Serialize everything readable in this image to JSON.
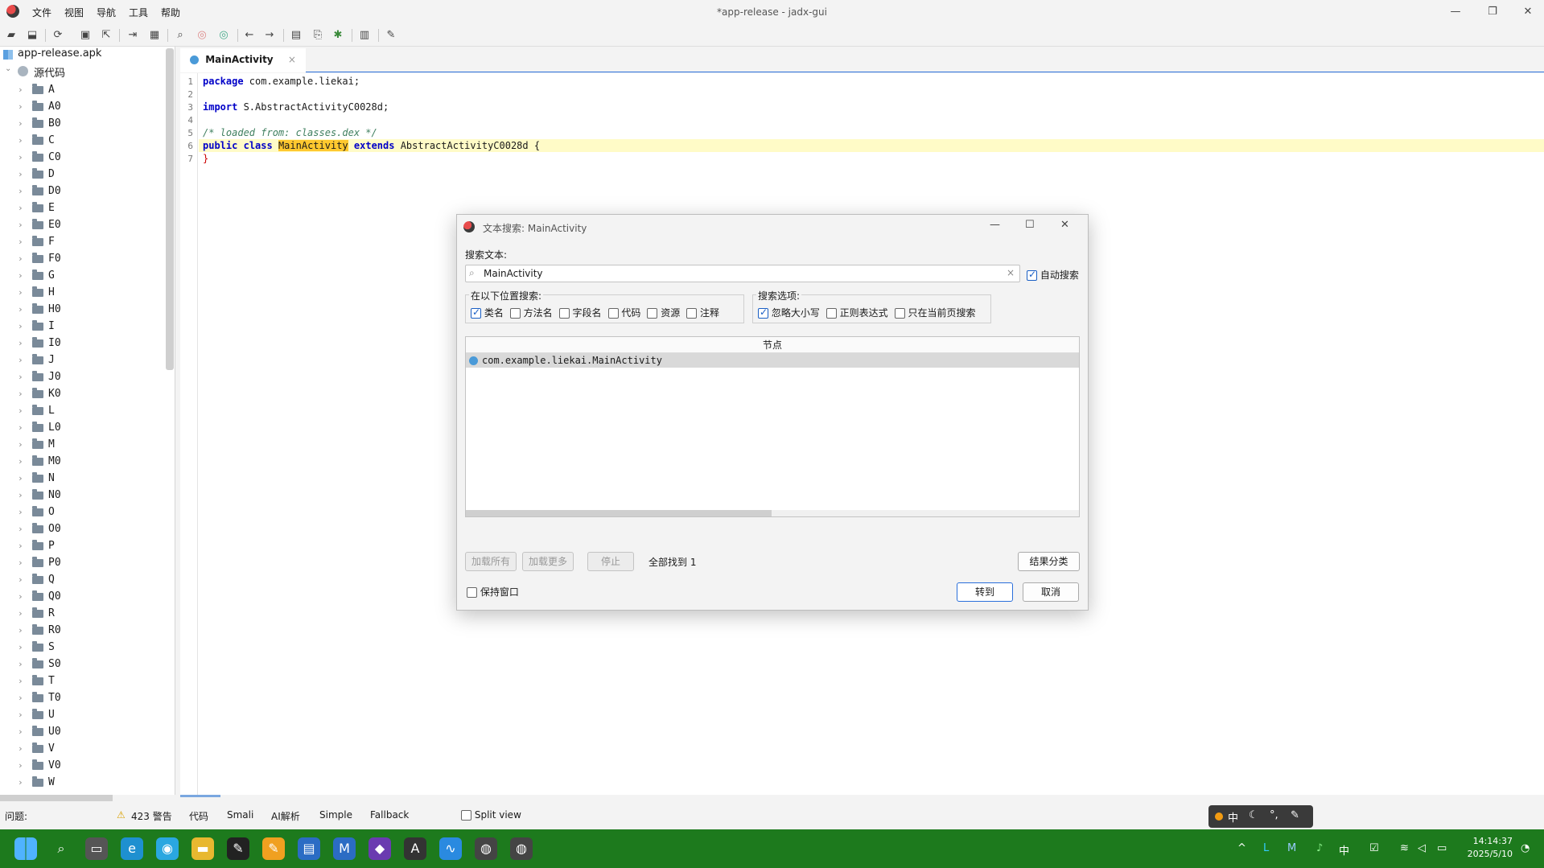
{
  "window": {
    "title": "*app-release - jadx-gui",
    "menu": [
      "文件",
      "视图",
      "导航",
      "工具",
      "帮助"
    ],
    "minimize": "—",
    "restore": "❐",
    "close": "✕"
  },
  "toolbar": {
    "icons": [
      "open-file-icon",
      "add-file-icon",
      "sync-icon",
      "save-icon",
      "export-icon",
      "flatten-icon",
      "packages-icon",
      "search-icon",
      "search-class-icon",
      "search-usage-icon",
      "back-icon",
      "forward-icon",
      "deobfuscation-icon",
      "bookmark-icon",
      "debug-icon",
      "log-icon",
      "settings-icon"
    ]
  },
  "tree": {
    "root_label": "app-release.apk",
    "source_label": "源代码",
    "folders": [
      "A",
      "A0",
      "B0",
      "C",
      "C0",
      "D",
      "D0",
      "E",
      "E0",
      "F",
      "F0",
      "G",
      "H",
      "H0",
      "I",
      "I0",
      "J",
      "J0",
      "K0",
      "L",
      "L0",
      "M",
      "M0",
      "N",
      "N0",
      "O",
      "O0",
      "P",
      "P0",
      "Q",
      "Q0",
      "R",
      "R0",
      "S",
      "S0",
      "T",
      "T0",
      "U",
      "U0",
      "V",
      "V0",
      "W"
    ]
  },
  "editor": {
    "tab_label": "MainActivity",
    "tab_close": "×",
    "lines": {
      "l1_kw": "package",
      "l1_rest": " com.example.liekai;",
      "l3_kw": "import",
      "l3_rest": " S.AbstractActivityC0028d;",
      "l5_comment": "/* loaded from: classes.dex */",
      "l6_kw1": "public",
      "l6_kw2": "class",
      "l6_hl": "MainActivity",
      "l6_kw3": "extends",
      "l6_rest": " AbstractActivityC0028d {",
      "l7": "}"
    }
  },
  "bottom": {
    "problems_label": "问题:",
    "warnings": "423 警告",
    "tabs": [
      "代码",
      "Smali",
      "AI解析",
      "Simple",
      "Fallback"
    ],
    "split_view": "Split view"
  },
  "dialog": {
    "title": "文本搜索: MainActivity",
    "search_label": "搜索文本:",
    "search_value": "MainActivity",
    "auto_search": "自动搜索",
    "search_in_title": "在以下位置搜索:",
    "search_in": [
      {
        "label": "类名",
        "checked": true
      },
      {
        "label": "方法名",
        "checked": false
      },
      {
        "label": "字段名",
        "checked": false
      },
      {
        "label": "代码",
        "checked": false
      },
      {
        "label": "资源",
        "checked": false
      },
      {
        "label": "注释",
        "checked": false
      }
    ],
    "options_title": "搜索选项:",
    "options": [
      {
        "label": "忽略大小写",
        "checked": true
      },
      {
        "label": "正则表达式",
        "checked": false
      },
      {
        "label": "只在当前页搜索",
        "checked": false
      }
    ],
    "results_header": "节点",
    "results": [
      "com.example.liekai.MainActivity"
    ],
    "load_all": "加载所有",
    "load_more": "加载更多",
    "stop": "停止",
    "found_text": "全部找到 1",
    "sort_results": "结果分类",
    "keep_open": "保持窗口",
    "goto": "转到",
    "cancel": "取消"
  },
  "ime": {
    "mode": "中"
  },
  "taskbar": {
    "tray_lang": "中",
    "time": "14:14:37",
    "date": "2025/5/10"
  }
}
